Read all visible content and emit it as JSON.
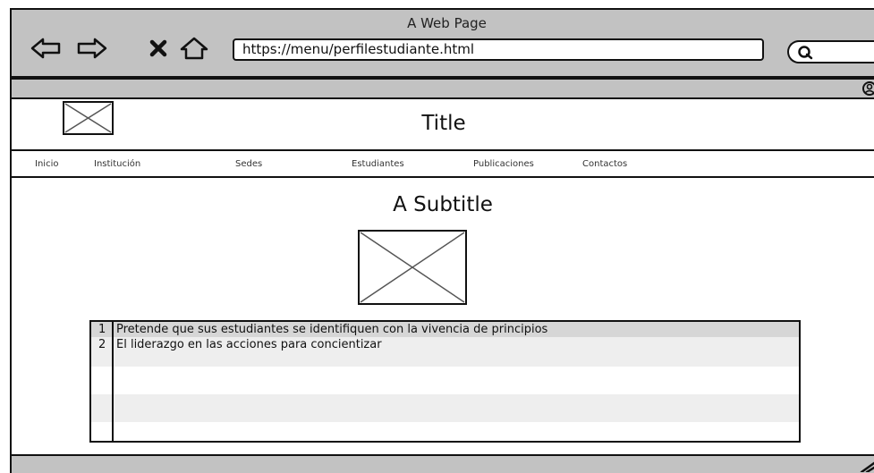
{
  "browser": {
    "window_title": "A Web Page",
    "url": "https://menu/perfilestudiante.html",
    "icons": [
      "back-arrow-icon",
      "forward-arrow-icon",
      "close-x-icon",
      "home-icon",
      "search-icon",
      "user-icon",
      "resize-icon"
    ]
  },
  "page": {
    "title": "Title",
    "subtitle": "A Subtitle",
    "nav": {
      "items": [
        "Inicio",
        "Institución",
        "Sedes",
        "Estudiantes",
        "Publicaciones",
        "Contactos"
      ]
    },
    "list": {
      "rows": [
        {
          "number": "1",
          "text": "Pretende que sus estudiantes se identifiquen con la vivencia de principios"
        },
        {
          "number": "2",
          "text": "El liderazgo en las acciones para concientizar"
        },
        {
          "number": "",
          "text": ""
        },
        {
          "number": "",
          "text": ""
        },
        {
          "number": "",
          "text": ""
        },
        {
          "number": "",
          "text": ""
        },
        {
          "number": "",
          "text": ""
        }
      ]
    }
  },
  "colors": {
    "chrome_gray": "#c2c2c2",
    "border": "#111111",
    "row_selected": "#d6d6d6",
    "row_alt": "#eeeeee"
  }
}
